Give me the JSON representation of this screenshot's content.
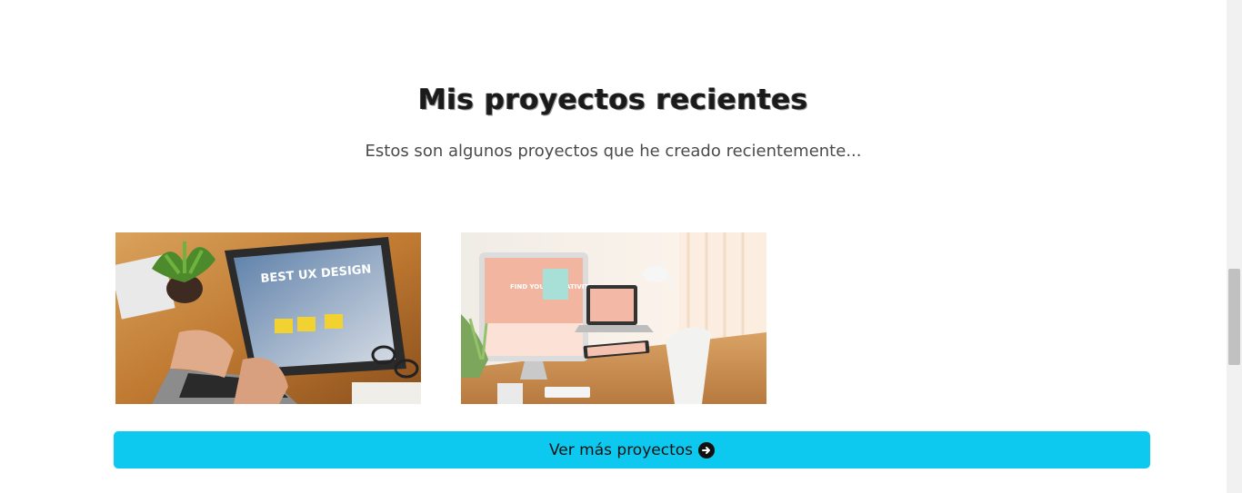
{
  "section": {
    "title": "Mis proyectos recientes",
    "subtitle": "Estos son algunos proyectos que he creado recientemente..."
  },
  "projects": [
    {
      "image": "laptop-web-design-photo",
      "screen_text": "BEST UX DESIGN"
    },
    {
      "image": "responsive-devices-desk-photo",
      "screen_text": "FIND YOUR CREATIVITY"
    }
  ],
  "cta": {
    "label": "Ver más proyectos",
    "icon": "arrow-circle-right-icon"
  },
  "colors": {
    "button": "#0dc9ef",
    "title": "#1a1a1a",
    "subtitle": "#4a4a4a"
  }
}
